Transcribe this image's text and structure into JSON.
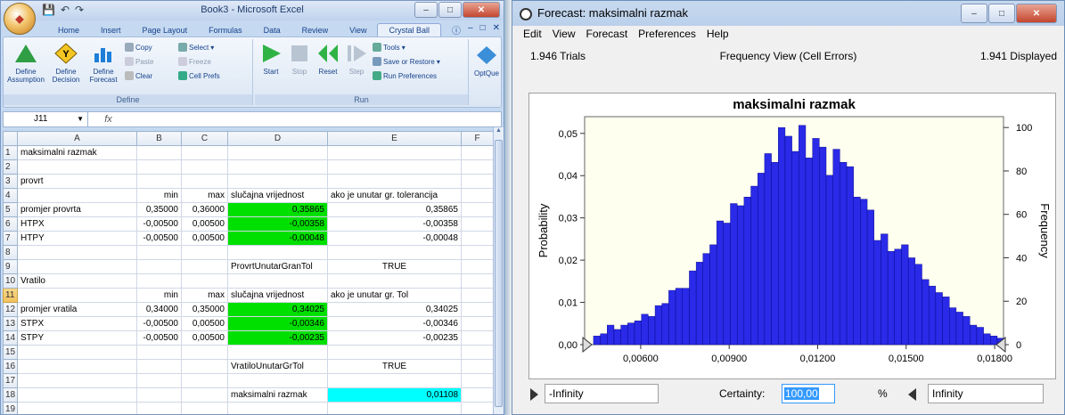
{
  "excel": {
    "title": "Book3 - Microsoft Excel",
    "tabs": [
      "Home",
      "Insert",
      "Page Layout",
      "Formulas",
      "Data",
      "Review",
      "View",
      "Crystal Ball"
    ],
    "active_tab": "Crystal Ball",
    "ribbon": {
      "define_assumption": "Define\nAssumption",
      "define_decision": "Define\nDecision",
      "define_forecast": "Define\nForecast",
      "copy": "Copy",
      "paste": "Paste",
      "clear": "Clear",
      "select": "Select",
      "freeze": "Freeze",
      "cell_prefs": "Cell Prefs",
      "group_define": "Define",
      "start": "Start",
      "stop": "Stop",
      "reset": "Reset",
      "step": "Step",
      "tools": "Tools",
      "save_restore": "Save or Restore",
      "run_prefs": "Run Preferences",
      "group_run": "Run",
      "optque": "OptQue"
    },
    "name_box": "J11",
    "fx": "fx",
    "columns": [
      "A",
      "B",
      "C",
      "D",
      "E",
      "F"
    ],
    "rows": [
      {
        "n": "1",
        "a": "maksimalni razmak",
        "b": "",
        "c": "",
        "d": "",
        "e": "",
        "dstyle": ""
      },
      {
        "n": "2",
        "a": "",
        "b": "",
        "c": "",
        "d": "",
        "e": "",
        "dstyle": ""
      },
      {
        "n": "3",
        "a": "provrt",
        "b": "",
        "c": "",
        "d": "",
        "e": "",
        "dstyle": ""
      },
      {
        "n": "4",
        "a": "",
        "b": "min",
        "c": "max",
        "d": "slučajna vrijednost",
        "e": "ako je unutar gr. tolerancija",
        "dstyle": ""
      },
      {
        "n": "5",
        "a": "promjer provrta",
        "b": "0,35000",
        "c": "0,36000",
        "d": "0,35865",
        "e": "0,35865",
        "dstyle": "green"
      },
      {
        "n": "6",
        "a": "HTPX",
        "b": "-0,00500",
        "c": "0,00500",
        "d": "-0,00358",
        "e": "-0,00358",
        "dstyle": "green"
      },
      {
        "n": "7",
        "a": "HTPY",
        "b": "-0,00500",
        "c": "0,00500",
        "d": "-0,00048",
        "e": "-0,00048",
        "dstyle": "green"
      },
      {
        "n": "8",
        "a": "",
        "b": "",
        "c": "",
        "d": "",
        "e": "",
        "dstyle": ""
      },
      {
        "n": "9",
        "a": "",
        "b": "",
        "c": "",
        "d": "ProvrtUnutarGranTol",
        "e": "TRUE",
        "dstyle": ""
      },
      {
        "n": "10",
        "a": "Vratilo",
        "b": "",
        "c": "",
        "d": "",
        "e": "",
        "dstyle": ""
      },
      {
        "n": "11",
        "a": "",
        "b": "min",
        "c": "max",
        "d": "slučajna vrijednost",
        "e": "ako je unutar gr. Tol",
        "dstyle": ""
      },
      {
        "n": "12",
        "a": "promjer vratila",
        "b": "0,34000",
        "c": "0,35000",
        "d": "0,34025",
        "e": "0,34025",
        "dstyle": "green"
      },
      {
        "n": "13",
        "a": "STPX",
        "b": "-0,00500",
        "c": "0,00500",
        "d": "-0,00346",
        "e": "-0,00346",
        "dstyle": "green"
      },
      {
        "n": "14",
        "a": "STPY",
        "b": "-0,00500",
        "c": "0,00500",
        "d": "-0,00235",
        "e": "-0,00235",
        "dstyle": "green"
      },
      {
        "n": "15",
        "a": "",
        "b": "",
        "c": "",
        "d": "",
        "e": "",
        "dstyle": ""
      },
      {
        "n": "16",
        "a": "",
        "b": "",
        "c": "",
        "d": "VratiloUnutarGrTol",
        "e": "TRUE",
        "dstyle": ""
      },
      {
        "n": "17",
        "a": "",
        "b": "",
        "c": "",
        "d": "",
        "e": "",
        "dstyle": ""
      },
      {
        "n": "18",
        "a": "",
        "b": "",
        "c": "",
        "d": "maksimalni razmak",
        "e": "0,01108",
        "dstyle": "",
        "estyle": "cyan"
      },
      {
        "n": "19",
        "a": "",
        "b": "",
        "c": "",
        "d": "",
        "e": "",
        "dstyle": ""
      }
    ]
  },
  "forecast": {
    "title": "Forecast: maksimalni razmak",
    "menu": [
      "Edit",
      "View",
      "Forecast",
      "Preferences",
      "Help"
    ],
    "trials": "1.946 Trials",
    "view": "Frequency View (Cell Errors)",
    "displayed": "1.941 Displayed",
    "left_field": "-Infinity",
    "certainty_label": "Certainty:",
    "certainty_value": "100,00",
    "pct": "%",
    "right_field": "Infinity"
  },
  "chart_data": {
    "type": "bar",
    "title": "maksimalni razmak",
    "ylabel": "Probability",
    "y2label": "Frequency",
    "x_ticks": [
      "0,00600",
      "0,00900",
      "0,01200",
      "0,01500",
      "0,01800"
    ],
    "x_tick_values": [
      0.006,
      0.009,
      0.012,
      0.015,
      0.018
    ],
    "y_ticks": [
      "0,00",
      "0,01",
      "0,02",
      "0,03",
      "0,04",
      "0,05"
    ],
    "y2_ticks": [
      "0",
      "20",
      "40",
      "60",
      "80",
      "100"
    ],
    "xlim": [
      0.0041,
      0.0183
    ],
    "ylim": [
      0,
      105
    ],
    "bin_start": 0.0044,
    "bin_width": 0.000232,
    "frequencies": [
      4,
      5,
      9,
      7,
      9,
      10,
      11,
      14,
      13,
      18,
      19,
      25,
      26,
      26,
      34,
      38,
      42,
      46,
      57,
      56,
      65,
      64,
      68,
      73,
      79,
      88,
      84,
      100,
      96,
      89,
      101,
      86,
      95,
      91,
      78,
      90,
      84,
      82,
      68,
      67,
      62,
      48,
      51,
      43,
      44,
      46,
      40,
      37,
      30,
      27,
      24,
      22,
      17,
      15,
      13,
      9,
      8,
      5,
      4,
      3
    ],
    "colors": {
      "bar": "#2a2ae8",
      "plot_bg": "#fffff0",
      "outline": "#000080"
    }
  }
}
